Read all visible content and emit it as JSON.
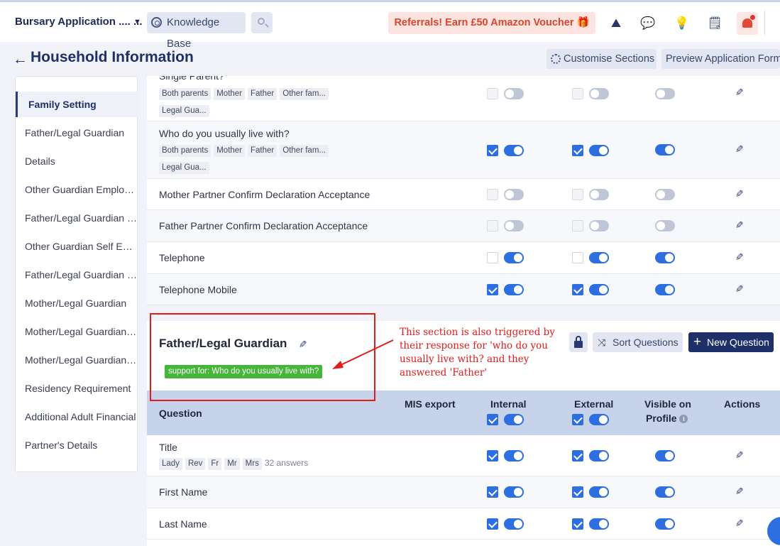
{
  "topbar": {
    "app_title": "Bursary Application .... ...",
    "knowledge_base": "Knowledge Base",
    "referral": "Referrals! Earn £50 Amazon Voucher 🎁",
    "icons": [
      "party-icon",
      "chat-icon",
      "bulb-icon",
      "notes-icon",
      "bell-icon"
    ]
  },
  "header": {
    "back": "←",
    "title": "Household Information",
    "customise": "Customise Sections",
    "preview": "Preview Application Forms"
  },
  "sidebar": {
    "items": [
      "Family Setting",
      "Father/Legal Guardian",
      "Details",
      "Other Guardian Employment",
      "Father/Legal Guardian Employment",
      "Other Guardian Self Employment",
      "Father/Legal Guardian Self Employment",
      "Mother/Legal Guardian",
      "Mother/Legal Guardian Employment",
      "Mother/Legal Guardian Self Employment",
      "Residency Requirement",
      "Additional Adult Financial",
      "Partner's Details"
    ]
  },
  "table1": {
    "rows": [
      {
        "label": "Single Parent?",
        "tags": [
          "Both parents",
          "Mother",
          "Father",
          "Other fam...",
          "Legal Gua..."
        ]
      },
      {
        "label": "Who do you usually live with?",
        "tags": [
          "Both parents",
          "Mother",
          "Father",
          "Other fam...",
          "Legal Gua..."
        ]
      },
      {
        "label": "Mother Partner Confirm Declaration Acceptance"
      },
      {
        "label": "Father Partner Confirm Declaration Acceptance"
      },
      {
        "label": "Telephone"
      },
      {
        "label": "Telephone Mobile"
      }
    ]
  },
  "section": {
    "title": "Father/Legal Guardian",
    "support_badge": "support for: Who do you usually live with?",
    "sort": "Sort Questions",
    "new_question": "New Question"
  },
  "table2": {
    "headers": {
      "question": "Question",
      "mis_export": "MIS export",
      "internal": "Internal",
      "external": "External",
      "visible_1": "Visible on",
      "visible_2": "Profile",
      "actions": "Actions"
    },
    "rows": [
      {
        "label": "Title",
        "tags": [
          "Lady",
          "Rev",
          "Fr",
          "Mr",
          "Mrs"
        ],
        "answers": "32 answers"
      },
      {
        "label": "First Name"
      },
      {
        "label": "Last Name"
      }
    ]
  },
  "annotation": {
    "text": "This section is also triggered by their response for 'who do you usually live with? and they answered 'Father'",
    "color": "#e31b1b"
  },
  "colors": {
    "brand": "#1f2f6a",
    "accent": "#2d6fe0",
    "badge_green": "#46b63a",
    "referral_red": "#d8462c"
  }
}
